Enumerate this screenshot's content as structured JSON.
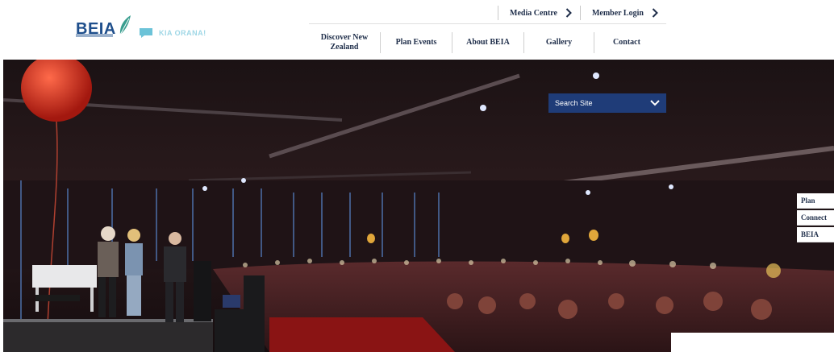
{
  "brand": {
    "logo_text": "BEIA",
    "badge_text": "KIA ORANA!"
  },
  "utility_nav": [
    {
      "label": "Media Centre"
    },
    {
      "label": "Member Login"
    }
  ],
  "main_nav": [
    {
      "label": "Discover New Zealand"
    },
    {
      "label": "Plan Events"
    },
    {
      "label": "About BEIA"
    },
    {
      "label": "Gallery"
    },
    {
      "label": "Contact"
    }
  ],
  "search": {
    "label": "Search Site"
  },
  "side_tabs": [
    {
      "label": "Plan"
    },
    {
      "label": "Connect"
    },
    {
      "label": "BEIA"
    }
  ],
  "colors": {
    "navy": "#1f3c78",
    "text_dark": "#1f2e4a",
    "brand_blue": "#1f4f8c",
    "leaf_teal": "#3a9e8f"
  },
  "icons": [
    "leaf-logo-icon",
    "chat-bubble-icon",
    "chevron-right-icon",
    "chevron-down-icon"
  ]
}
